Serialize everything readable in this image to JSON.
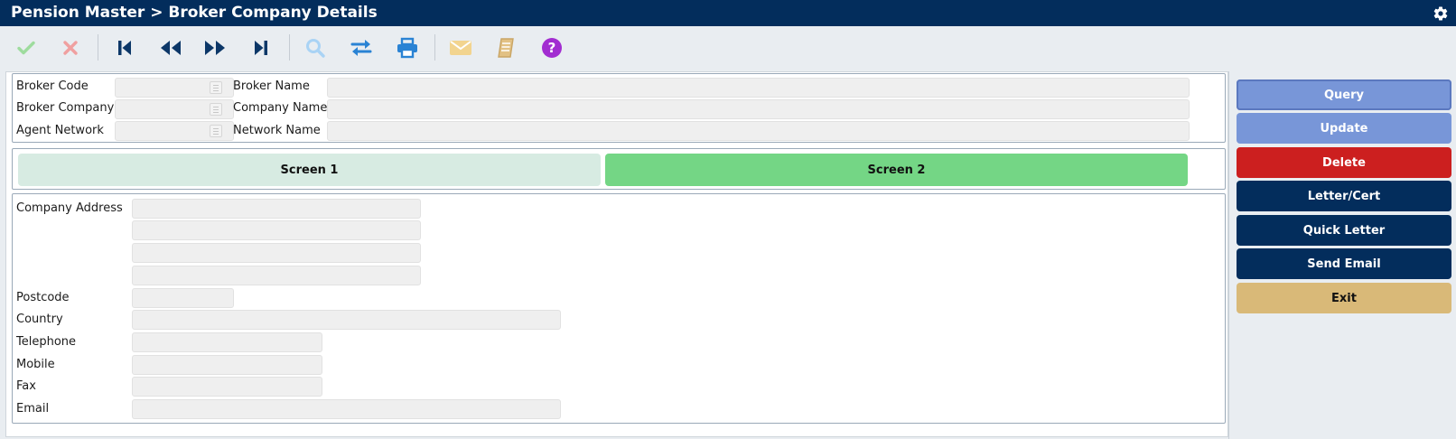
{
  "title": "Pension Master > Broker Company Details",
  "toolbar": {
    "icons": [
      "confirm-check-icon",
      "cancel-x-icon",
      "first-record-icon",
      "previous-record-icon",
      "next-record-icon",
      "last-record-icon",
      "search-icon",
      "swap-icon",
      "print-icon",
      "email-icon",
      "notes-book-icon",
      "help-icon"
    ]
  },
  "header": {
    "broker_code_label": "Broker Code",
    "broker_name_label": "Broker Name",
    "broker_company_label": "Broker Company",
    "company_name_label": "Company Name",
    "agent_network_label": "Agent Network",
    "network_name_label": "Network Name",
    "broker_code_value": "",
    "broker_name_value": "",
    "broker_company_value": "",
    "company_name_value": "",
    "agent_network_value": "",
    "network_name_value": ""
  },
  "tabs": [
    {
      "label": "Screen 1",
      "active": false
    },
    {
      "label": "Screen 2",
      "active": true
    }
  ],
  "details": {
    "company_address_label": "Company Address",
    "address_lines": [
      "",
      "",
      "",
      ""
    ],
    "postcode_label": "Postcode",
    "postcode_value": "",
    "country_label": "Country",
    "country_value": "",
    "telephone_label": "Telephone",
    "telephone_value": "",
    "mobile_label": "Mobile",
    "mobile_value": "",
    "fax_label": "Fax",
    "fax_value": "",
    "email_label": "Email",
    "email_value": ""
  },
  "actions": {
    "query": "Query",
    "update": "Update",
    "delete": "Delete",
    "letter_cert": "Letter/Cert",
    "quick_letter": "Quick Letter",
    "send_email": "Send Email",
    "exit": "Exit"
  },
  "colors": {
    "titlebar": "#032d5c",
    "tab_active": "#74d685",
    "tab_inactive": "#d7ebe2",
    "query_update": "#7896d8",
    "delete": "#cc1f1f",
    "navy_button": "#032d5c",
    "exit": "#d9b978"
  }
}
